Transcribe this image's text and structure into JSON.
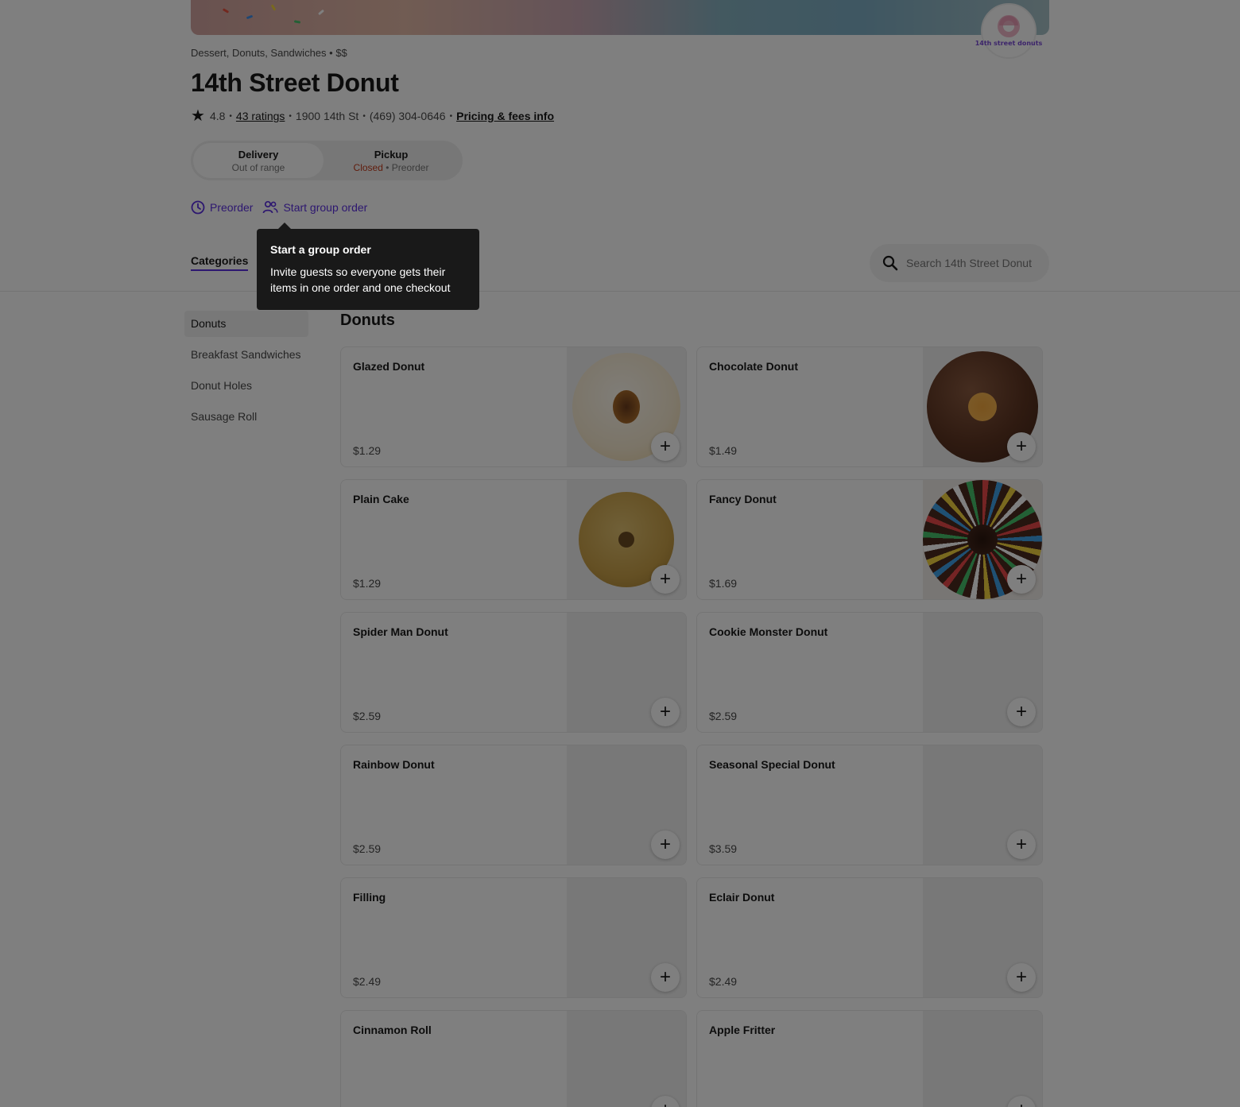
{
  "store": {
    "cuisine": "Dessert, Donuts, Sandwiches",
    "price_range": "$$",
    "name": "14th Street Donut",
    "logo_text": "14th street donuts",
    "rating": "4.8",
    "ratings_count": "43 ratings",
    "address": "1900 14th St",
    "phone": "(469) 304-0646",
    "pricing_link": "Pricing & fees info"
  },
  "fulfillment": {
    "delivery_label": "Delivery",
    "delivery_status": "Out of range",
    "pickup_label": "Pickup",
    "pickup_status_closed": "Closed",
    "pickup_status_preorder": "Preorder"
  },
  "actions": {
    "preorder": "Preorder",
    "group_order": "Start group order"
  },
  "tooltip": {
    "title": "Start a group order",
    "body": "Invite guests so everyone gets their items in one order and one checkout"
  },
  "tabs": {
    "categories": "Categories"
  },
  "search": {
    "placeholder": "Search 14th Street Donut"
  },
  "sidebar": {
    "items": [
      {
        "label": "Donuts"
      },
      {
        "label": "Breakfast Sandwiches"
      },
      {
        "label": "Donut Holes"
      },
      {
        "label": "Sausage Roll"
      }
    ]
  },
  "menu": {
    "section_title": "Donuts",
    "items": [
      {
        "name": "Glazed Donut",
        "price": "$1.29"
      },
      {
        "name": "Chocolate Donut",
        "price": "$1.49"
      },
      {
        "name": "Plain Cake",
        "price": "$1.29"
      },
      {
        "name": "Fancy Donut",
        "price": "$1.69"
      },
      {
        "name": "Spider Man Donut",
        "price": "$2.59"
      },
      {
        "name": "Cookie Monster Donut",
        "price": "$2.59"
      },
      {
        "name": "Rainbow Donut",
        "price": "$2.59"
      },
      {
        "name": "Seasonal Special Donut",
        "price": "$3.59"
      },
      {
        "name": "Filling",
        "price": "$2.49"
      },
      {
        "name": "Eclair Donut",
        "price": "$2.49"
      },
      {
        "name": "Cinnamon Roll",
        "price": ""
      },
      {
        "name": "Apple Fritter",
        "price": ""
      }
    ]
  },
  "colors": {
    "accent": "#5b2fe0",
    "closed": "#c23a1b"
  },
  "icons": [
    "star-icon",
    "clock-icon",
    "people-icon",
    "search-icon",
    "plus-icon"
  ]
}
